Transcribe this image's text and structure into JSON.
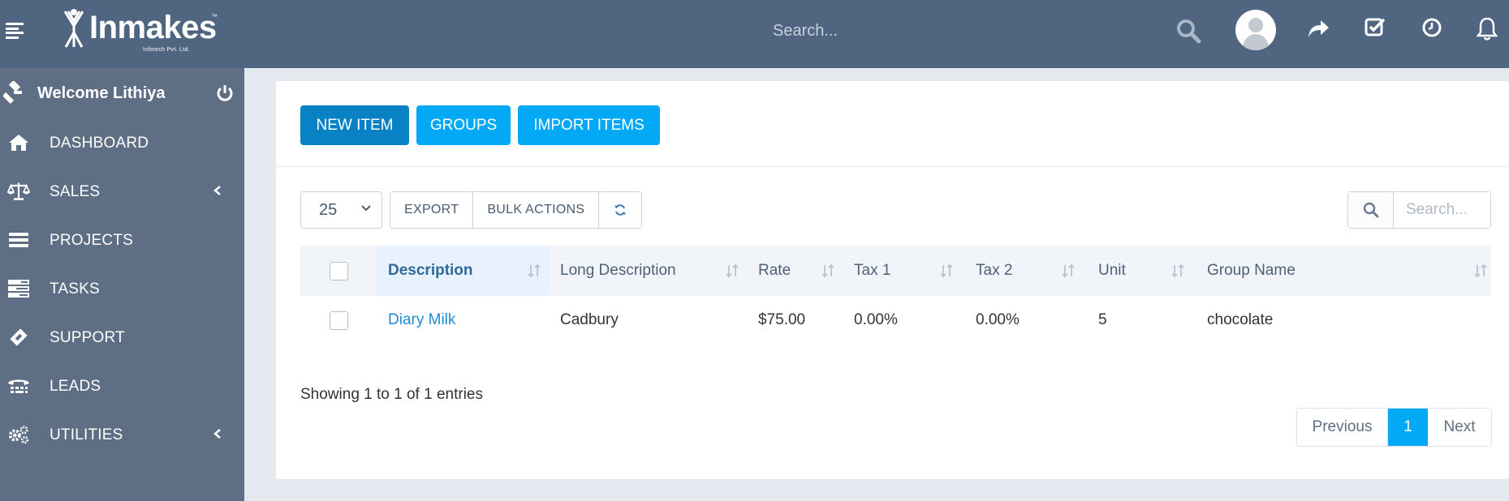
{
  "header": {
    "logo_text": "Inmakes",
    "logo_tm": "™",
    "logo_sub": "Infotech Pvt. Ltd.",
    "search_placeholder": "Search...",
    "icons": [
      "menu-icon",
      "search-icon",
      "avatar",
      "share-icon",
      "checklist-icon",
      "clock-icon",
      "bell-icon"
    ]
  },
  "sidebar": {
    "welcome": "Welcome Lithiya",
    "items": [
      {
        "label": "DASHBOARD",
        "icon": "home-icon"
      },
      {
        "label": "SALES",
        "icon": "balance-scale-icon",
        "expandable": true
      },
      {
        "label": "PROJECTS",
        "icon": "bars-icon"
      },
      {
        "label": "TASKS",
        "icon": "tasks-icon"
      },
      {
        "label": "SUPPORT",
        "icon": "ticket-icon"
      },
      {
        "label": "LEADS",
        "icon": "tty-icon"
      },
      {
        "label": "UTILITIES",
        "icon": "cogs-icon",
        "expandable": true
      }
    ]
  },
  "toolbar": {
    "new_item": "NEW ITEM",
    "groups": "GROUPS",
    "import_items": "IMPORT ITEMS"
  },
  "table_controls": {
    "page_size": "25",
    "export": "EXPORT",
    "bulk_actions": "BULK ACTIONS",
    "search_placeholder": "Search..."
  },
  "table": {
    "columns": [
      "Description",
      "Long Description",
      "Rate",
      "Tax 1",
      "Tax 2",
      "Unit",
      "Group Name"
    ],
    "rows": [
      {
        "description": "Diary Milk",
        "long_description": "Cadbury",
        "rate": "$75.00",
        "tax1": "0.00%",
        "tax2": "0.00%",
        "unit": "5",
        "group_name": "chocolate"
      }
    ]
  },
  "footer": {
    "info": "Showing 1 to 1 of 1 entries",
    "prev": "Previous",
    "page": "1",
    "next": "Next"
  },
  "colors": {
    "header_bg": "#506580",
    "sidebar_bg": "#5d6e85",
    "primary": "#0882c4",
    "info": "#03a9f4",
    "link": "#1f8bd6"
  }
}
